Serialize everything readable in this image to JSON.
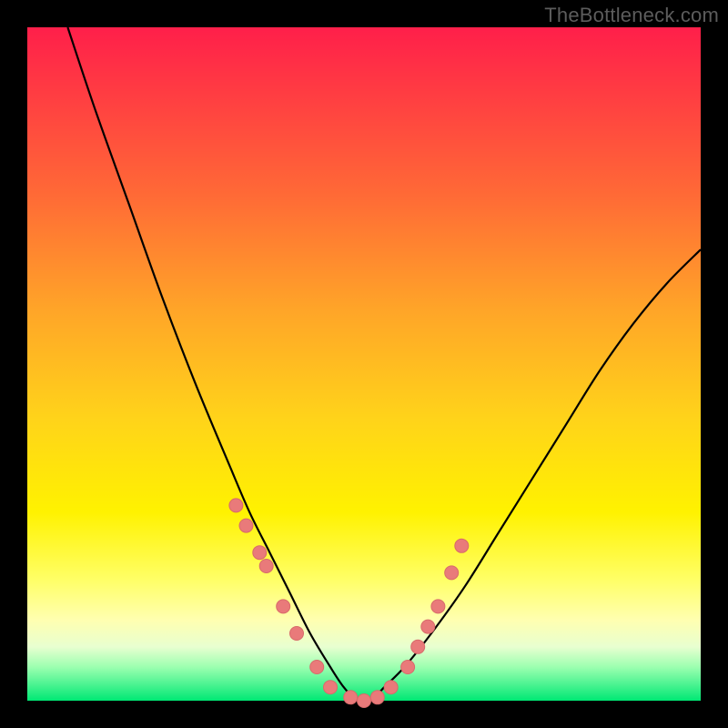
{
  "watermark": "TheBottleneck.com",
  "colors": {
    "frame": "#000000",
    "curve": "#000000",
    "marker_fill": "#e97a7a",
    "marker_stroke": "#d86a6a"
  },
  "chart_data": {
    "type": "line",
    "title": "",
    "xlabel": "",
    "ylabel": "",
    "xlim": [
      0,
      100
    ],
    "ylim": [
      0,
      100
    ],
    "series": [
      {
        "name": "bottleneck-curve",
        "x": [
          6,
          10,
          15,
          20,
          25,
          30,
          33,
          36,
          39,
          42,
          45,
          47,
          49,
          51,
          53,
          56,
          60,
          65,
          70,
          75,
          80,
          85,
          90,
          95,
          100
        ],
        "y": [
          100,
          88,
          74,
          60,
          47,
          35,
          28,
          22,
          16,
          10,
          5,
          2,
          0,
          0,
          2,
          5,
          10,
          17,
          25,
          33,
          41,
          49,
          56,
          62,
          67
        ]
      }
    ],
    "markers": {
      "name": "highlight-points",
      "x": [
        31,
        32.5,
        34.5,
        35.5,
        38,
        40,
        43,
        45,
        48,
        50,
        52,
        54,
        56.5,
        58,
        59.5,
        61,
        63,
        64.5
      ],
      "y": [
        29,
        26,
        22,
        20,
        14,
        10,
        5,
        2,
        0.5,
        0,
        0.5,
        2,
        5,
        8,
        11,
        14,
        19,
        23
      ]
    }
  }
}
